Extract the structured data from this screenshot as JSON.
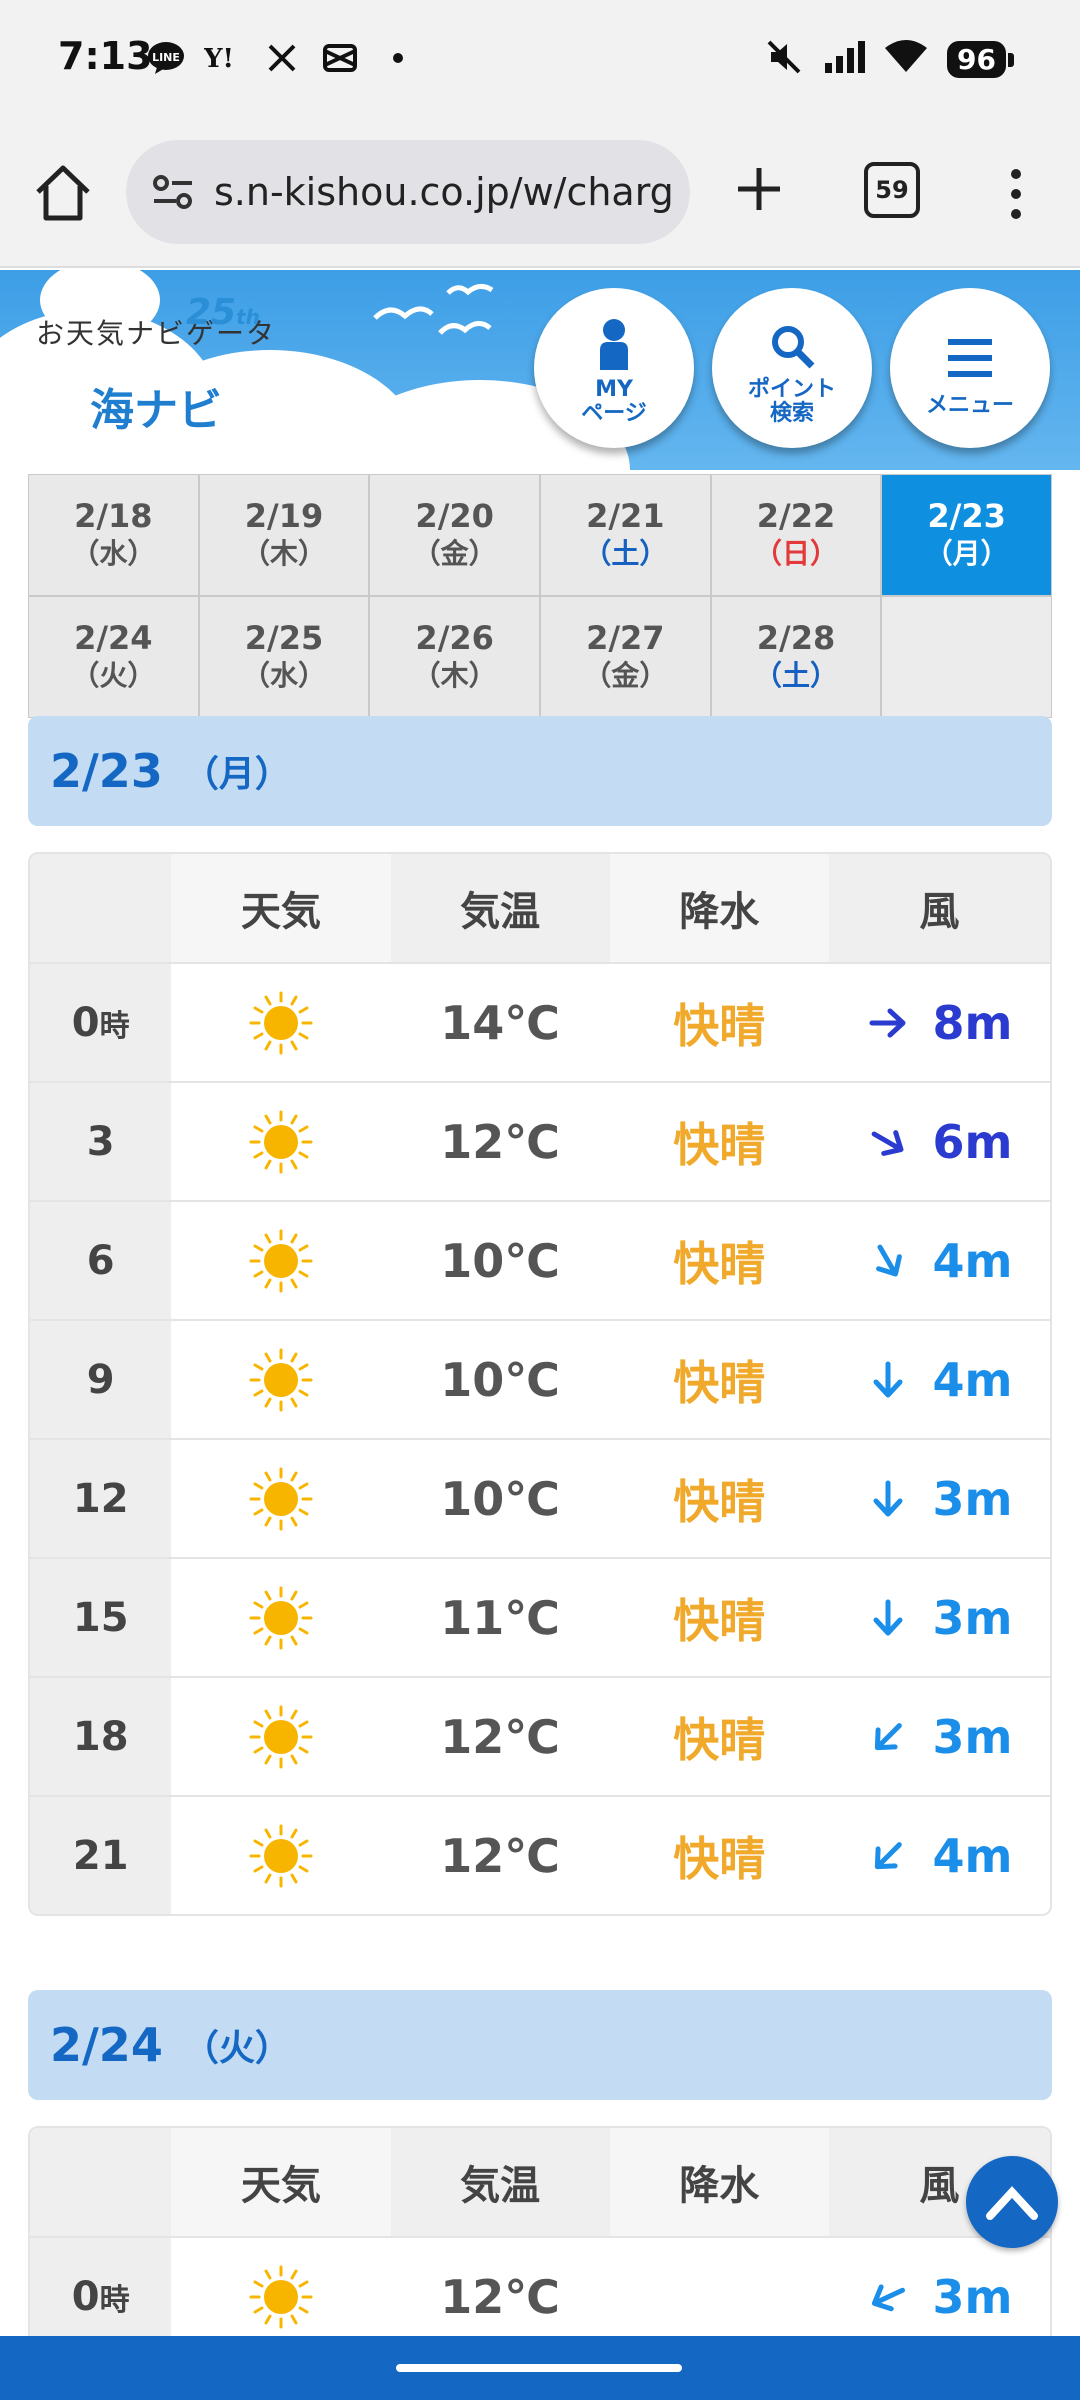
{
  "status": {
    "time": "7:13",
    "battery": "96",
    "icons_left": [
      "line-icon",
      "yahoo-icon",
      "x-icon",
      "capcut-icon",
      "dot-icon"
    ],
    "icons_right": [
      "mute-icon",
      "signal-icon",
      "wifi-icon"
    ]
  },
  "browser": {
    "url": "s.n-kishou.co.jp/w/charg",
    "tab_count": "59"
  },
  "site": {
    "logo_text": "お天気ナビゲータ",
    "logo_25": "25",
    "logo_th": "th",
    "logo_sub": "海ナビ",
    "my_page": [
      "MY",
      "ページ"
    ],
    "point_search": [
      "ポイント",
      "検索"
    ],
    "menu": "メニュー"
  },
  "dates": [
    {
      "d": "2/18",
      "w": "（水）",
      "type": "normal"
    },
    {
      "d": "2/19",
      "w": "（木）",
      "type": "normal"
    },
    {
      "d": "2/20",
      "w": "（金）",
      "type": "normal"
    },
    {
      "d": "2/21",
      "w": "（土）",
      "type": "sat"
    },
    {
      "d": "2/22",
      "w": "（日）",
      "type": "sun"
    },
    {
      "d": "2/23",
      "w": "（月）",
      "type": "active"
    },
    {
      "d": "2/24",
      "w": "（火）",
      "type": "normal"
    },
    {
      "d": "2/25",
      "w": "（水）",
      "type": "normal"
    },
    {
      "d": "2/26",
      "w": "（木）",
      "type": "normal"
    },
    {
      "d": "2/27",
      "w": "（金）",
      "type": "normal"
    },
    {
      "d": "2/28",
      "w": "（土）",
      "type": "sat"
    },
    {
      "d": "",
      "w": "",
      "type": "empty"
    }
  ],
  "headers": {
    "weather": "天気",
    "temp": "気温",
    "precip": "降水",
    "wind": "風"
  },
  "days": [
    {
      "date": "2/23",
      "week": "（月）",
      "rows": [
        {
          "hour": "0",
          "unit": "時",
          "temp": "14℃",
          "precip": "快晴",
          "wind": "8m",
          "dir": "E",
          "tone": "dark"
        },
        {
          "hour": "3",
          "unit": "",
          "temp": "12℃",
          "precip": "快晴",
          "wind": "6m",
          "dir": "SE",
          "tone": "dark"
        },
        {
          "hour": "6",
          "unit": "",
          "temp": "10℃",
          "precip": "快晴",
          "wind": "4m",
          "dir": "SSE",
          "tone": "light"
        },
        {
          "hour": "9",
          "unit": "",
          "temp": "10℃",
          "precip": "快晴",
          "wind": "4m",
          "dir": "S",
          "tone": "light"
        },
        {
          "hour": "12",
          "unit": "",
          "temp": "10℃",
          "precip": "快晴",
          "wind": "3m",
          "dir": "S",
          "tone": "light"
        },
        {
          "hour": "15",
          "unit": "",
          "temp": "11℃",
          "precip": "快晴",
          "wind": "3m",
          "dir": "S",
          "tone": "light"
        },
        {
          "hour": "18",
          "unit": "",
          "temp": "12℃",
          "precip": "快晴",
          "wind": "3m",
          "dir": "SW",
          "tone": "light"
        },
        {
          "hour": "21",
          "unit": "",
          "temp": "12℃",
          "precip": "快晴",
          "wind": "4m",
          "dir": "SW",
          "tone": "light"
        }
      ]
    },
    {
      "date": "2/24",
      "week": "（火）",
      "rows": [
        {
          "hour": "0",
          "unit": "時",
          "temp": "12℃",
          "precip": "",
          "wind": "3m",
          "dir": "WSW",
          "tone": "light"
        }
      ]
    }
  ],
  "colors": {
    "accent": "#1467c2",
    "active_date": "#0f8fe0",
    "sun": "#f7b500",
    "precip": "#f0a92a"
  }
}
